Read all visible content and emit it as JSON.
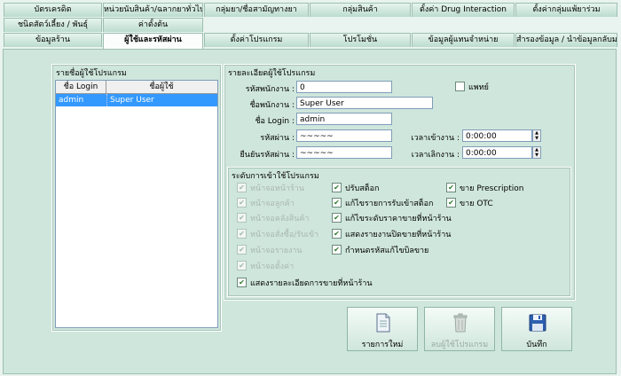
{
  "tabs_row1": [
    "บัตรเครดิต",
    "หน่วยนับสินค้า/ฉลากยาทั่วไป",
    "กลุ่มยา/ชื่อสามัญทางยา",
    "กลุ่มสินค้า",
    "ตั้งค่า Drug Interaction",
    "ตั้งค่ากลุ่มแพ้ยาร่วม"
  ],
  "tabs_row2": [
    "ชนิดสัตว์เลี้ยง / พันธุ์",
    "ค่าตั้งต้น"
  ],
  "tabs_row3": [
    "ข้อมูลร้าน",
    "ผู้ใช้และรหัสผ่าน",
    "ตั้งค่าโปรแกรม",
    "โปรโมชั่น",
    "ข้อมูลผู้แทนจำหน่าย",
    "สำรองข้อมูล / นำข้อมูลกลับมา"
  ],
  "user_list": {
    "title": "รายชื่อผู้ใช้โปรแกรม",
    "col_login": "ชื่อ Login",
    "col_user": "ชื่อผู้ใช้",
    "rows": [
      {
        "login": "admin",
        "name": "Super User"
      }
    ]
  },
  "detail": {
    "title": "รายละเอียดผู้ใช้โปรแกรม",
    "emp_code_label": "รหัสพนักงาน :",
    "emp_code": "0",
    "doctor_label": "แพทย์",
    "emp_name_label": "ชื่อพนักงาน :",
    "emp_name": "Super User",
    "login_label": "ชื่อ Login :",
    "login": "admin",
    "password_label": "รหัสผ่าน :",
    "password": "~~~~~",
    "confirm_label": "ยืนยันรหัสผ่าน :",
    "confirm": "~~~~~",
    "time_in_label": "เวลาเข้างาน :",
    "time_in": "0:00:00",
    "time_out_label": "เวลาเลิกงาน :",
    "time_out": "0:00:00"
  },
  "access": {
    "title": "ระดับการเข้าใช้โปรแกรม",
    "col1": [
      "หน้าจอหน้าร้าน",
      "หน้าจอลูกค้า",
      "หน้าจอคลังสินค้า",
      "หน้าจอสั่งซื้อ/รับเข้า",
      "หน้าจอรายงาน",
      "หน้าจอตั้งค่า"
    ],
    "col2": [
      "ปรับสต็อก",
      "แก้ไขรายการรับเข้าสต็อก",
      "แก้ไขระดับราคาขายที่หน้าร้าน",
      "แสดงรายงานปิดขายที่หน้าร้าน",
      "กำหนดรหัสแก้ไขบิลขาย"
    ],
    "col3": [
      "ขาย Prescription",
      "ขาย OTC"
    ],
    "bottom": "แสดงรายละเอียดการขายที่หน้าร้าน"
  },
  "buttons": {
    "new": "รายการใหม่",
    "delete": "ลบผู้ใช้โปรแกรม",
    "save": "บันทึก"
  }
}
